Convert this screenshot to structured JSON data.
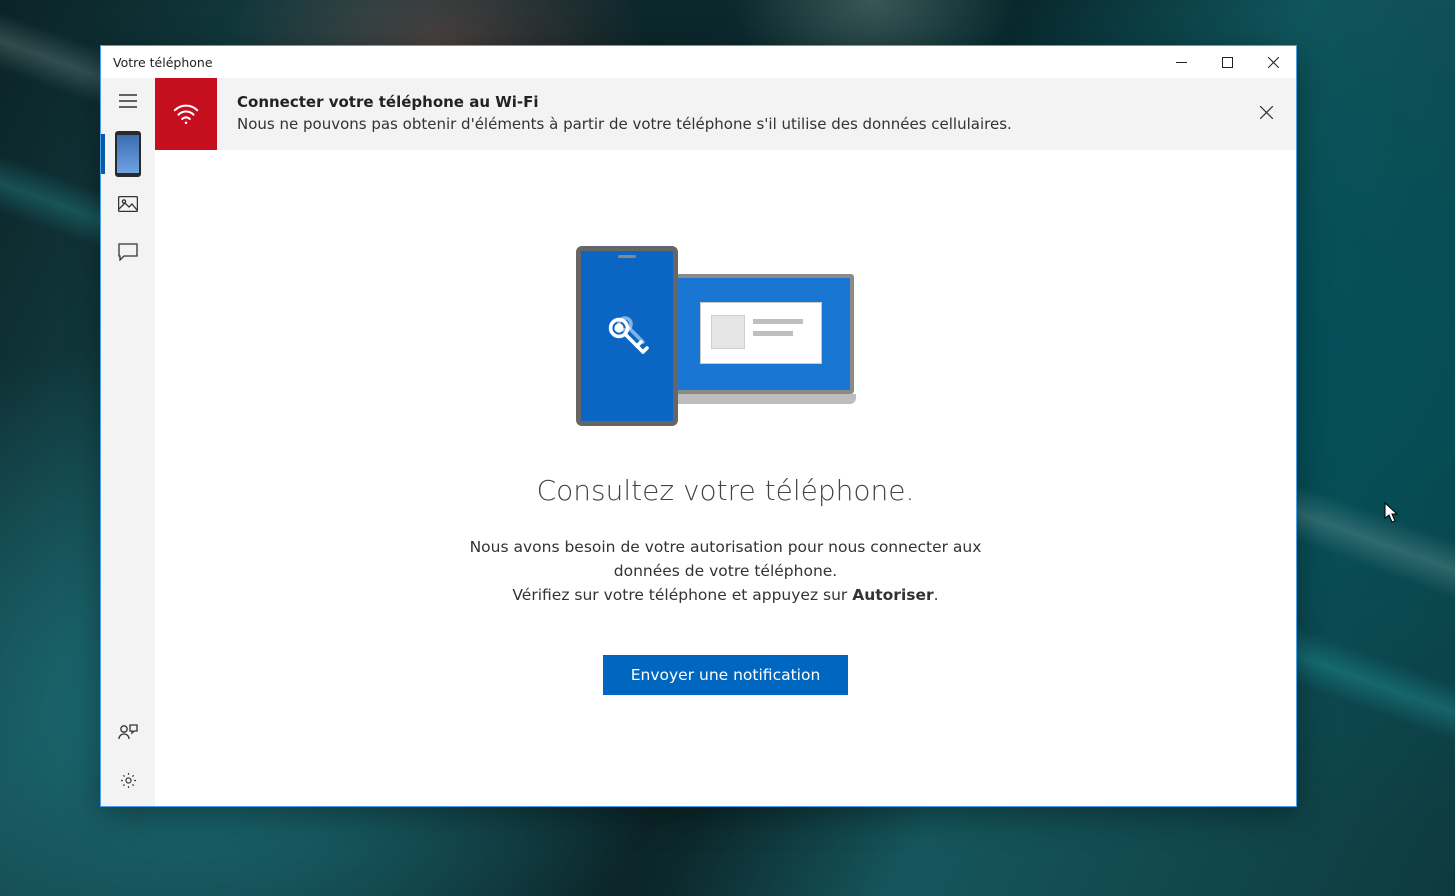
{
  "window": {
    "title": "Votre téléphone"
  },
  "banner": {
    "title": "Connecter votre téléphone au Wi-Fi",
    "body": "Nous ne pouvons pas obtenir d'éléments à partir de votre téléphone s'il utilise des données cellulaires."
  },
  "main": {
    "headline": "Consultez votre téléphone.",
    "line1": "Nous avons besoin de votre autorisation pour nous connecter aux données de votre téléphone.",
    "line2_prefix": "Vérifiez sur votre téléphone et appuyez sur ",
    "line2_bold": "Autoriser",
    "line2_suffix": ".",
    "button": "Envoyer une notification"
  },
  "sidebar": {
    "items": [
      "menu",
      "phone",
      "photos",
      "messages",
      "feedback",
      "settings"
    ]
  }
}
